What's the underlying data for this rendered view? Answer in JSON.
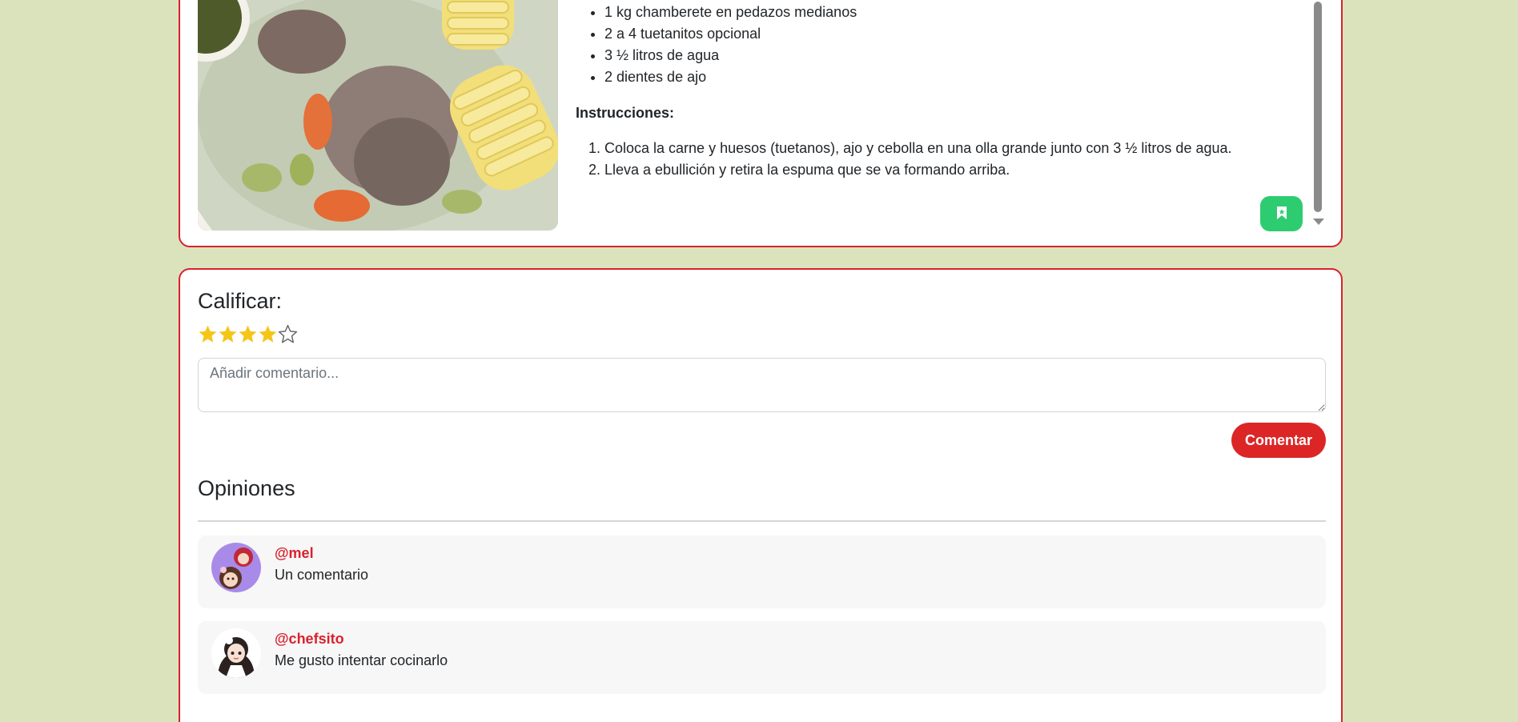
{
  "recipe": {
    "ingredients": [
      "1 kg chamberete en pedazos medianos",
      "2 a 4 tuetanitos opcional",
      "3 ½ litros de agua",
      "2 dientes de ajo"
    ],
    "instructions_heading": "Instrucciones:",
    "instructions": [
      "Coloca la carne y huesos (tuetanos), ajo y cebolla en una olla grande junto con 3 ½ litros de agua.",
      "Lleva a ebullición y retira la espuma que se va formando arriba."
    ],
    "save_icon": "bookmark-icon"
  },
  "rating": {
    "title": "Calificar:",
    "value": 4,
    "max": 5,
    "star_color": "#f5c518"
  },
  "comment_form": {
    "placeholder": "Añadir comentario...",
    "value": "",
    "submit_label": "Comentar"
  },
  "opinions": {
    "title": "Opiniones",
    "items": [
      {
        "user": "@mel",
        "text": "Un comentario"
      },
      {
        "user": "@chefsito",
        "text": "Me gusto intentar cocinarlo"
      }
    ]
  },
  "colors": {
    "background": "#dbe3bc",
    "accent_red": "#d8222d",
    "save_green": "#2ecc71"
  }
}
